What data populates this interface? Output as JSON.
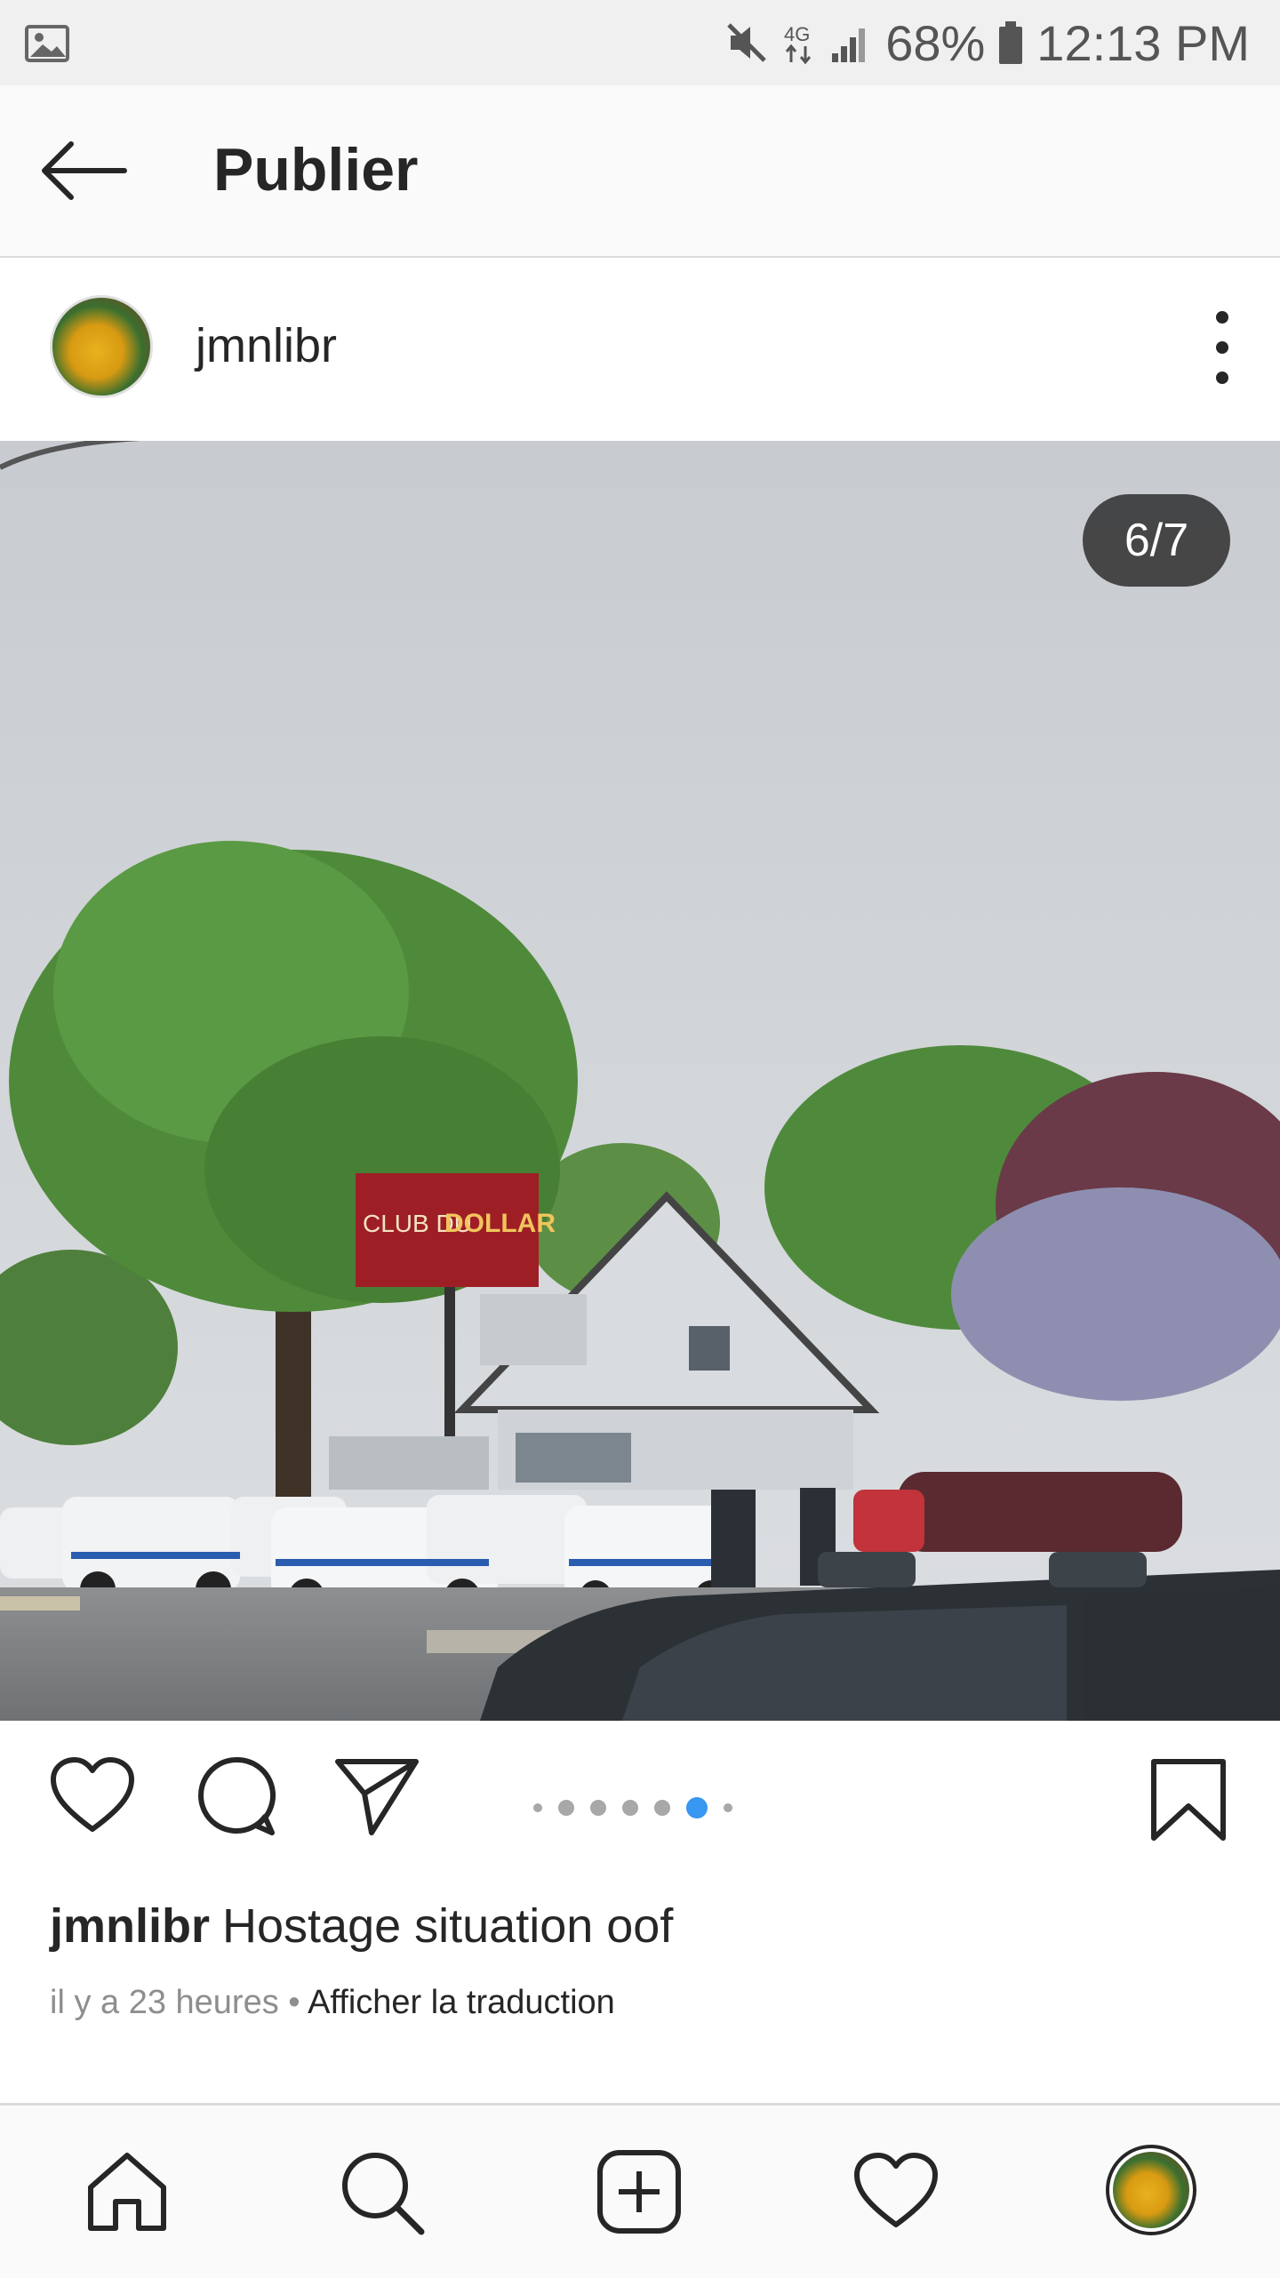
{
  "status_bar": {
    "battery": "68%",
    "time": "12:13 PM",
    "network": "4G"
  },
  "app_bar": {
    "title": "Publier"
  },
  "post": {
    "username": "jmnlibr",
    "image_counter": "6/7",
    "carousel": {
      "total": 7,
      "current": 6
    },
    "caption_user": "jmnlibr",
    "caption_text": "Hostage situation oof",
    "timestamp": "il y a 23 heures",
    "separator": "•",
    "translate_link": "Afficher la traduction"
  },
  "photo_sign": {
    "line1": "CLUB DU",
    "line2": "DOLLAR"
  },
  "colors": {
    "accent": "#3897f0",
    "text": "#262626",
    "muted": "#8e8e8e"
  },
  "icons": {
    "status_left": "gallery-icon",
    "mute": "mute-icon",
    "signal": "signal-icon",
    "battery": "battery-icon",
    "back": "arrow-left-icon",
    "more": "more-vertical-icon",
    "like": "heart-icon",
    "comment": "comment-icon",
    "share": "send-icon",
    "save": "bookmark-icon",
    "nav_home": "home-icon",
    "nav_search": "search-icon",
    "nav_add": "add-post-icon",
    "nav_activity": "heart-icon",
    "nav_profile": "profile-avatar"
  }
}
